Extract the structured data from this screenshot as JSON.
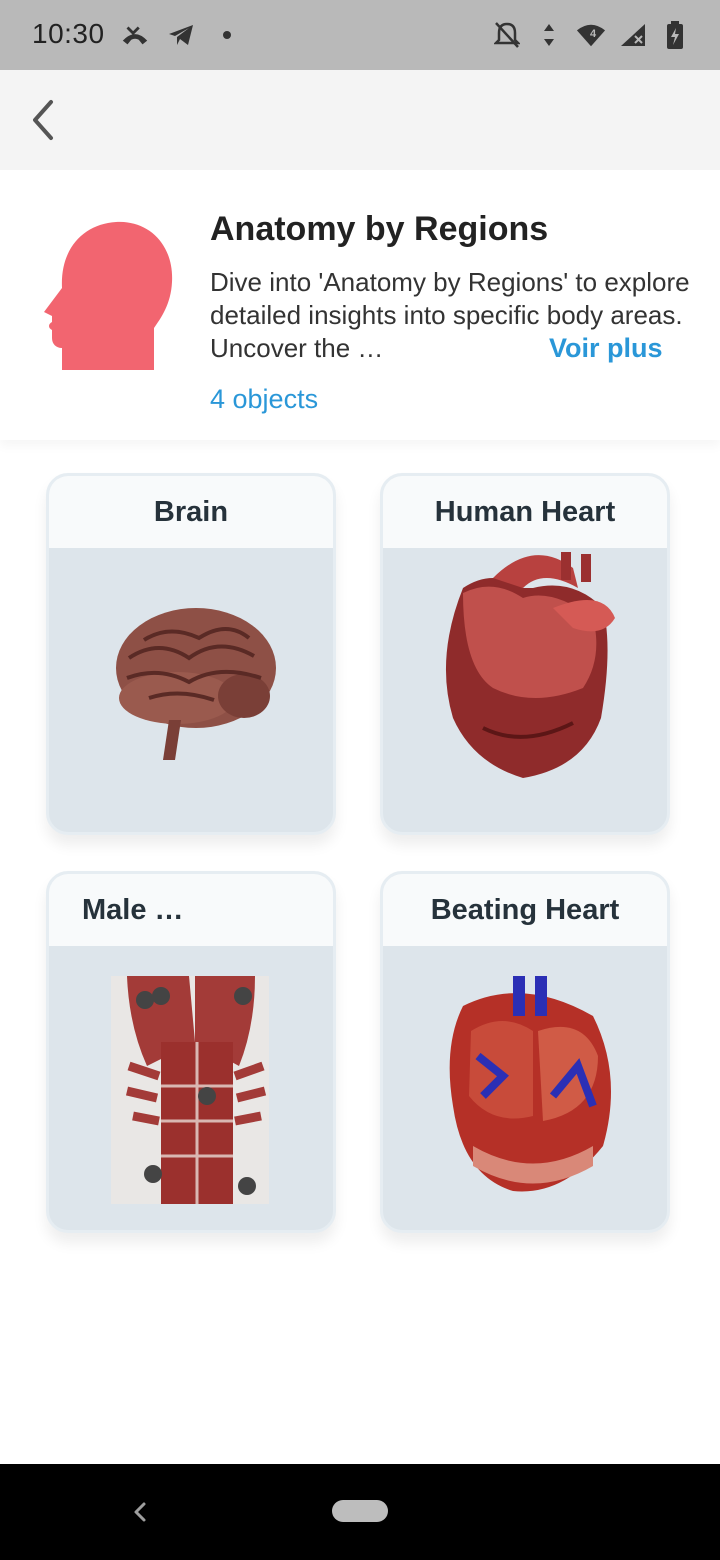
{
  "status_bar": {
    "time": "10:30",
    "icons_left": [
      "missed-call-icon",
      "telegram-icon",
      "dot-icon"
    ],
    "icons_right": [
      "mute-bell-icon",
      "data-arrows-icon",
      "wifi-icon",
      "signal-icon",
      "battery-charging-icon"
    ],
    "wifi_badge": "4"
  },
  "app_bar": {
    "back_icon": "chevron-left-icon"
  },
  "category": {
    "icon": "human-head-icon",
    "icon_color": "#f26570",
    "title": "Anatomy by Regions",
    "description": "Dive into 'Anatomy by Regions' to explore detailed insights into specific body areas. Uncover the …",
    "more_label": "Voir plus",
    "count_label": "4 objects",
    "accent_color": "#2a97d8"
  },
  "cards": [
    {
      "title": "Brain",
      "image": "brain-image"
    },
    {
      "title": "Human Heart",
      "image": "heart-image"
    },
    {
      "title": "Male …",
      "image": "muscles-image"
    },
    {
      "title": "Beating Heart",
      "image": "beating-heart-image"
    }
  ],
  "nav_bar": {
    "back_icon": "nav-back-icon",
    "home_icon": "home-pill-icon"
  }
}
